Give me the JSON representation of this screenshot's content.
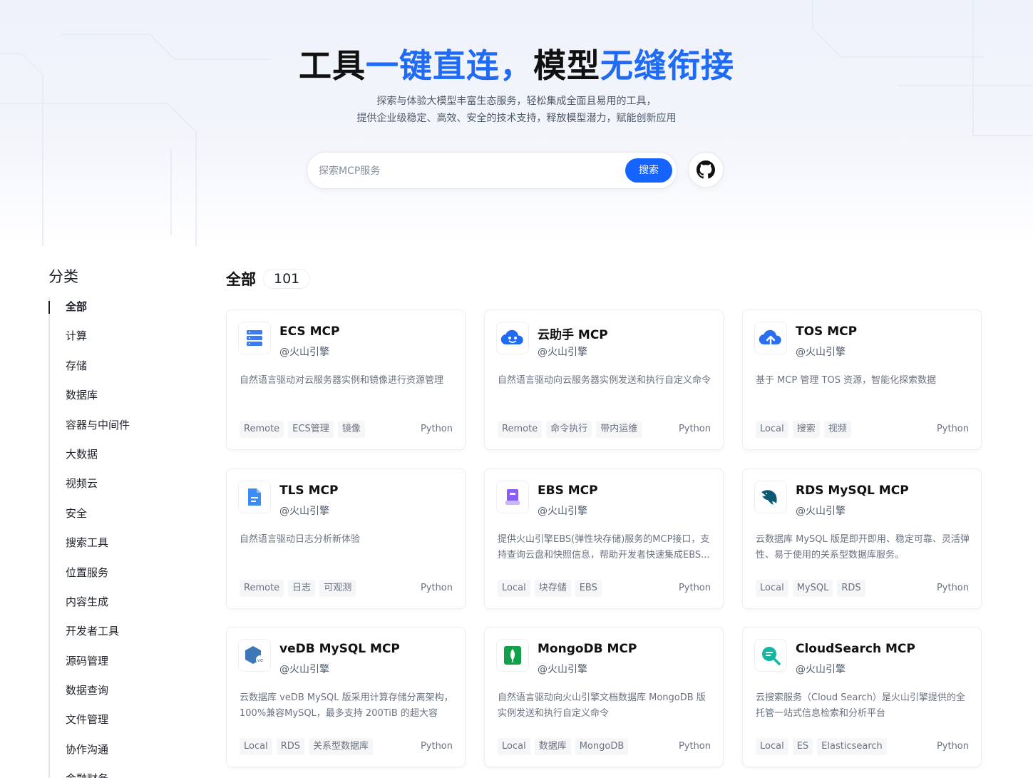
{
  "hero": {
    "title_part1": "工具",
    "title_part2": "一键直连，",
    "title_part3": "模型",
    "title_part4": "无缝衔接",
    "subtitle_line1": "探索与体验大模型丰富生态服务，轻松集成全面且易用的工具，",
    "subtitle_line2": "提供企业级稳定、高效、安全的技术支持，释放模型潜力，赋能创新应用"
  },
  "search": {
    "placeholder": "探索MCP服务",
    "button_label": "搜索"
  },
  "sidebar": {
    "title": "分类",
    "items": [
      {
        "label": "全部",
        "active": true
      },
      {
        "label": "计算"
      },
      {
        "label": "存储"
      },
      {
        "label": "数据库"
      },
      {
        "label": "容器与中间件"
      },
      {
        "label": "大数据"
      },
      {
        "label": "视频云"
      },
      {
        "label": "安全"
      },
      {
        "label": "搜索工具"
      },
      {
        "label": "位置服务"
      },
      {
        "label": "内容生成"
      },
      {
        "label": "开发者工具"
      },
      {
        "label": "源码管理"
      },
      {
        "label": "数据查询"
      },
      {
        "label": "文件管理"
      },
      {
        "label": "协作沟通"
      },
      {
        "label": "金融财务"
      }
    ]
  },
  "main": {
    "title": "全部",
    "count": "101"
  },
  "cards": [
    {
      "name": "ECS MCP",
      "author": "@火山引擎",
      "desc": "自然语言驱动对云服务器实例和镜像进行资源管理",
      "tags": [
        "Remote",
        "ECS管理",
        "镜像"
      ],
      "lang": "Python",
      "icon": "server-icon",
      "color": "#3b7cf5"
    },
    {
      "name": "云助手 MCP",
      "author": "@火山引擎",
      "desc": "自然语言驱动向云服务器实例发送和执行自定义命令",
      "tags": [
        "Remote",
        "命令执行",
        "带内运维"
      ],
      "lang": "Python",
      "icon": "cloud-assistant-icon",
      "color": "#1f6bf5"
    },
    {
      "name": "TOS MCP",
      "author": "@火山引擎",
      "desc": "基于 MCP 管理 TOS 资源，智能化探索数据",
      "tags": [
        "Local",
        "搜索",
        "视频"
      ],
      "lang": "Python",
      "icon": "cloud-upload-icon",
      "color": "#2a6ff0"
    },
    {
      "name": "TLS MCP",
      "author": "@火山引擎",
      "desc": "自然语言驱动日志分析新体验",
      "tags": [
        "Remote",
        "日志",
        "可观测"
      ],
      "lang": "Python",
      "icon": "log-file-icon",
      "color": "#3b8cf5"
    },
    {
      "name": "EBS MCP",
      "author": "@火山引擎",
      "desc": "提供火山引擎EBS(弹性块存储)服务的MCP接口，支持查询云盘和快照信息，帮助开发者快速集成EBS...",
      "tags": [
        "Local",
        "块存储",
        "EBS"
      ],
      "lang": "Python",
      "icon": "block-storage-icon",
      "color": "#8b5cf6"
    },
    {
      "name": "RDS MySQL MCP",
      "author": "@火山引擎",
      "desc": "云数据库 MySQL 版是即开即用、稳定可靠、灵活弹性、易于使用的关系型数据库服务。",
      "tags": [
        "Local",
        "MySQL",
        "RDS"
      ],
      "lang": "Python",
      "icon": "mysql-dolphin-icon",
      "color": "#0f5a73"
    },
    {
      "name": "veDB MySQL MCP",
      "author": "@火山引擎",
      "desc": "云数据库 veDB MySQL 版采用计算存储分离架构，100%兼容MySQL，最多支持 200TiB 的超大容量...",
      "tags": [
        "Local",
        "RDS",
        "关系型数据库"
      ],
      "lang": "Python",
      "icon": "vedb-icon",
      "color": "#3c78b8"
    },
    {
      "name": "MongoDB MCP",
      "author": "@火山引擎",
      "desc": "自然语言驱动向火山引擎文档数据库 MongoDB 版实例发送和执行自定义命令",
      "tags": [
        "Local",
        "数据库",
        "MongoDB"
      ],
      "lang": "Python",
      "icon": "mongodb-leaf-icon",
      "color": "#12a14a"
    },
    {
      "name": "CloudSearch MCP",
      "author": "@火山引擎",
      "desc": "云搜索服务（Cloud Search）是火山引擎提供的全托管一站式信息检索和分析平台",
      "tags": [
        "Local",
        "ES",
        "Elasticsearch"
      ],
      "lang": "Python",
      "icon": "cloud-search-icon",
      "color": "#11b7a3"
    }
  ]
}
